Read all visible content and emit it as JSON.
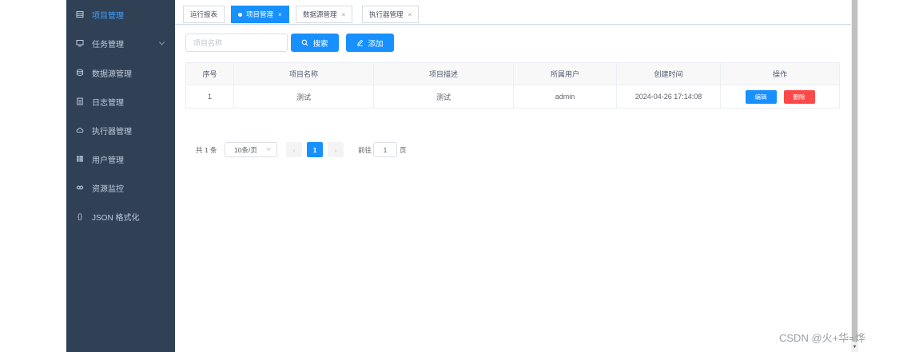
{
  "sidebar": {
    "items": [
      {
        "label": "项目管理",
        "icon": "table-icon",
        "active": true
      },
      {
        "label": "任务管理",
        "icon": "monitor-icon",
        "expandable": true
      },
      {
        "label": "数据源管理",
        "icon": "database-icon"
      },
      {
        "label": "日志管理",
        "icon": "document-icon"
      },
      {
        "label": "执行器管理",
        "icon": "cloud-icon"
      },
      {
        "label": "用户管理",
        "icon": "grid-icon"
      },
      {
        "label": "资源监控",
        "icon": "link-icon"
      },
      {
        "label": "JSON 格式化",
        "icon": "braces-icon"
      }
    ]
  },
  "tags": [
    {
      "label": "运行报表",
      "active": false,
      "closable": false
    },
    {
      "label": "项目管理",
      "active": true,
      "closable": true
    },
    {
      "label": "数据源管理",
      "active": false,
      "closable": true
    },
    {
      "label": "执行器管理",
      "active": false,
      "closable": true
    }
  ],
  "toolbar": {
    "search_placeholder": "项目名称",
    "search_button": "搜索",
    "add_button": "添加"
  },
  "table": {
    "columns": [
      "序号",
      "项目名称",
      "项目描述",
      "所属用户",
      "创建时间",
      "操作"
    ],
    "rows": [
      {
        "index": "1",
        "name": "测试",
        "description": "测试",
        "user": "admin",
        "created": "2024-04-26 17:14:08"
      }
    ],
    "edit_label": "编辑",
    "delete_label": "删除"
  },
  "pagination": {
    "total_text": "共 1 条",
    "page_size": "10条/页",
    "current_page": "1",
    "goto_label": "前往",
    "goto_value": "1",
    "page_suffix": "页"
  },
  "watermark": "CSDN @火+华=烨",
  "colors": {
    "sidebar_bg": "#304156",
    "sidebar_text": "#bfcbd9",
    "active": "#409eff",
    "primary": "#1890ff",
    "danger": "#ff4949"
  }
}
